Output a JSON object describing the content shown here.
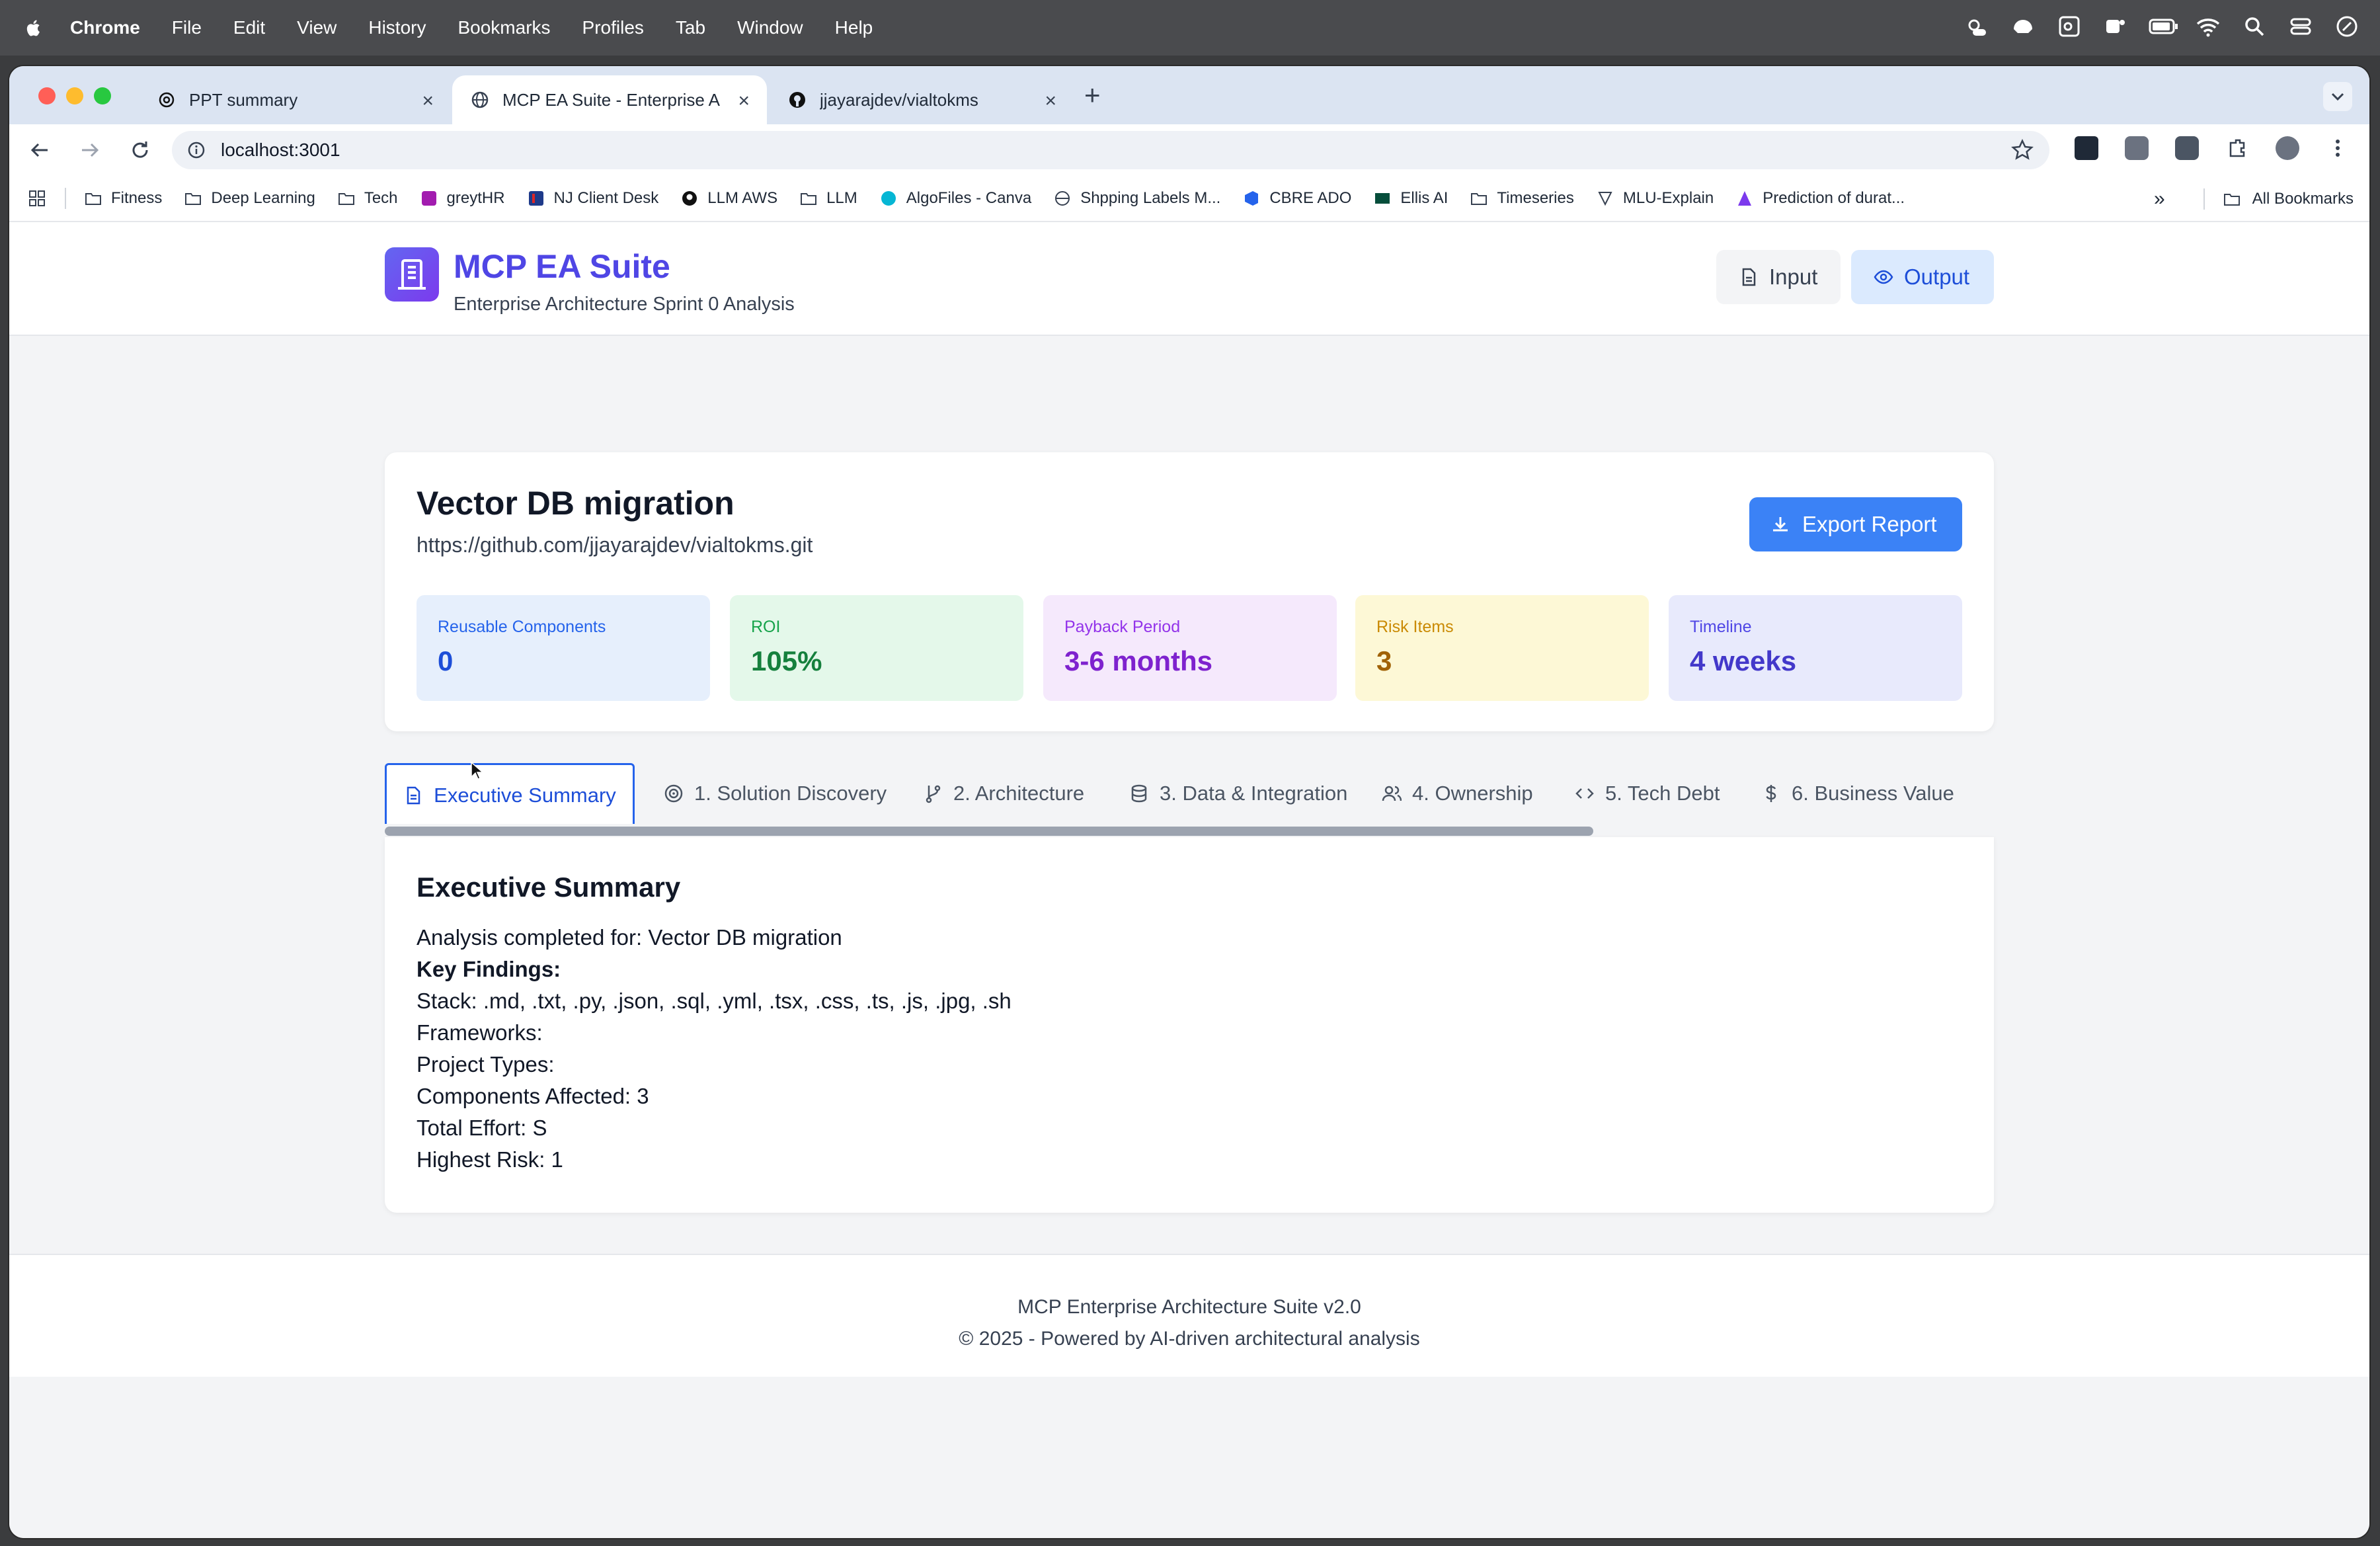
{
  "menubar": {
    "app": "Chrome",
    "items": [
      "File",
      "Edit",
      "View",
      "History",
      "Bookmarks",
      "Profiles",
      "Tab",
      "Window",
      "Help"
    ]
  },
  "browser": {
    "tabs": [
      {
        "title": "PPT summary",
        "icon": "openai-icon"
      },
      {
        "title": "MCP EA Suite - Enterprise Ar",
        "icon": "globe-icon"
      },
      {
        "title": "jjayarajdev/vialtokms",
        "icon": "github-icon"
      }
    ],
    "url": "localhost:3001",
    "bookmarks": [
      {
        "label": "Fitness",
        "icon": "folder-icon"
      },
      {
        "label": "Deep Learning",
        "icon": "folder-icon"
      },
      {
        "label": "Tech",
        "icon": "folder-icon"
      },
      {
        "label": "greytHR",
        "icon": "greythr-icon"
      },
      {
        "label": "NJ Client Desk",
        "icon": "nj-icon"
      },
      {
        "label": "LLM AWS",
        "icon": "github-icon"
      },
      {
        "label": "LLM",
        "icon": "folder-icon"
      },
      {
        "label": "AlgoFiles - Canva",
        "icon": "canva-icon"
      },
      {
        "label": "Shpping Labels M...",
        "icon": "globe-icon"
      },
      {
        "label": "CBRE ADO",
        "icon": "azure-devops-icon"
      },
      {
        "label": "Ellis AI",
        "icon": "cbre-icon"
      },
      {
        "label": "Timeseries",
        "icon": "folder-icon"
      },
      {
        "label": "MLU-Explain",
        "icon": "mlu-icon"
      },
      {
        "label": "Prediction of durat...",
        "icon": "article-icon"
      }
    ],
    "all_bookmarks": "All Bookmarks"
  },
  "header": {
    "title": "MCP EA Suite",
    "subtitle": "Enterprise Architecture Sprint 0 Analysis",
    "input_label": "Input",
    "output_label": "Output"
  },
  "project": {
    "name": "Vector DB migration",
    "repo": "https://github.com/jjayarajdev/vialtokms.git",
    "export_label": "Export Report"
  },
  "metrics": [
    {
      "label": "Reusable Components",
      "value": "0",
      "bg": "#e6effc",
      "label_color": "#2563eb",
      "value_color": "#1d4ed8"
    },
    {
      "label": "ROI",
      "value": "105%",
      "bg": "#e4f8ea",
      "label_color": "#16a34a",
      "value_color": "#15803d"
    },
    {
      "label": "Payback Period",
      "value": "3-6 months",
      "bg": "#f5e9fc",
      "label_color": "#9333ea",
      "value_color": "#7e22ce"
    },
    {
      "label": "Risk Items",
      "value": "3",
      "bg": "#fdf8d6",
      "label_color": "#ca8a04",
      "value_color": "#a16207"
    },
    {
      "label": "Timeline",
      "value": "4 weeks",
      "bg": "#e8eafc",
      "label_color": "#4f46e5",
      "value_color": "#4338ca"
    }
  ],
  "tabs": [
    {
      "label": "Executive Summary",
      "icon": "document-icon"
    },
    {
      "label": "1. Solution Discovery",
      "icon": "target-icon"
    },
    {
      "label": "2. Architecture",
      "icon": "git-branch-icon"
    },
    {
      "label": "3. Data & Integration",
      "icon": "database-icon"
    },
    {
      "label": "4. Ownership",
      "icon": "users-icon"
    },
    {
      "label": "5. Tech Debt",
      "icon": "code-icon"
    },
    {
      "label": "6. Business Value",
      "icon": "dollar-icon"
    }
  ],
  "executive_summary": {
    "title": "Executive Summary",
    "analysis": "Analysis completed for: Vector DB migration",
    "key_findings": "Key Findings:",
    "stack": "Stack: .md, .txt, .py, .json, .sql, .yml, .tsx, .css, .ts, .js, .jpg, .sh",
    "frameworks": "Frameworks:",
    "project_types": "Project Types:",
    "components": "Components Affected: 3",
    "effort": "Total Effort: S",
    "risk": "Highest Risk: 1"
  },
  "footer": {
    "line1": "MCP Enterprise Architecture Suite v2.0",
    "line2": "© 2025 - Powered by AI-driven architectural analysis"
  },
  "colors": {
    "accent": "#4f46e5",
    "primary_button": "#3b82f6",
    "active_tab": "#2563eb"
  }
}
